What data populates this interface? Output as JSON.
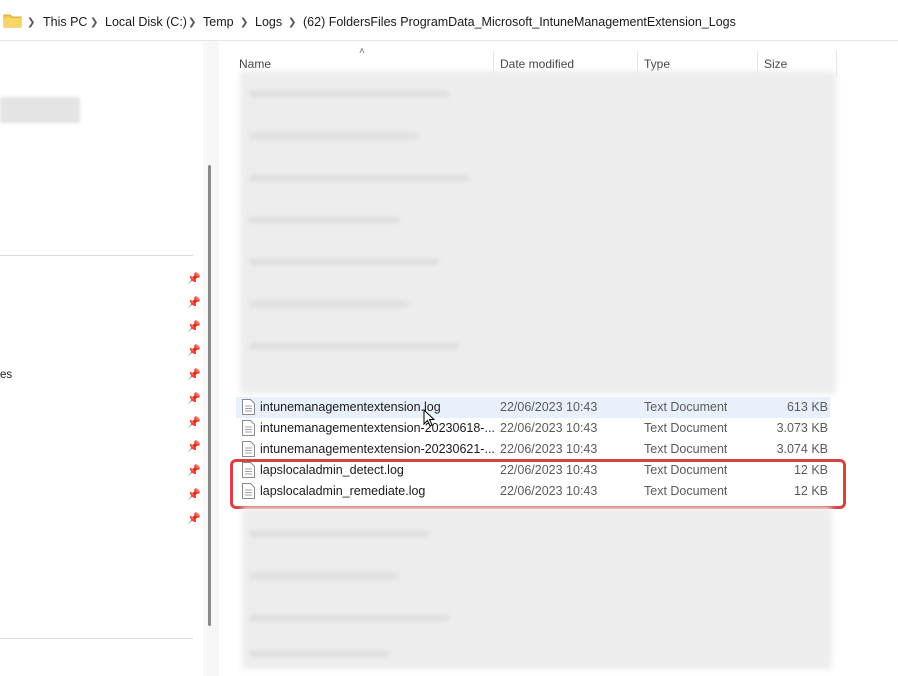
{
  "breadcrumb": {
    "items": [
      "This PC",
      "Local Disk (C:)",
      "Temp",
      "Logs",
      "(62) FoldersFiles ProgramData_Microsoft_IntuneManagementExtension_Logs"
    ]
  },
  "nav": {
    "partial_label": "es"
  },
  "columns": {
    "name": "Name",
    "date": "Date modified",
    "type": "Type",
    "size": "Size"
  },
  "files": [
    {
      "name": "intunemanagementextension.log",
      "date": "22/06/2023 10:43",
      "type": "Text Document",
      "size": "613 KB"
    },
    {
      "name": "intunemanagementextension-20230618-...",
      "date": "22/06/2023 10:43",
      "type": "Text Document",
      "size": "3.073 KB"
    },
    {
      "name": "intunemanagementextension-20230621-...",
      "date": "22/06/2023 10:43",
      "type": "Text Document",
      "size": "3.074 KB"
    },
    {
      "name": "lapslocaladmin_detect.log",
      "date": "22/06/2023 10:43",
      "type": "Text Document",
      "size": "12 KB"
    },
    {
      "name": "lapslocaladmin_remediate.log",
      "date": "22/06/2023 10:43",
      "type": "Text Document",
      "size": "12 KB"
    }
  ],
  "colors": {
    "highlight": "#d94242",
    "hover_row": "#e8f1fb",
    "folder": "#f2c94c"
  },
  "icons": {
    "folder": "folder-icon",
    "file": "text-file-icon",
    "pin": "pin-icon",
    "separator": "chevron-right-icon"
  }
}
